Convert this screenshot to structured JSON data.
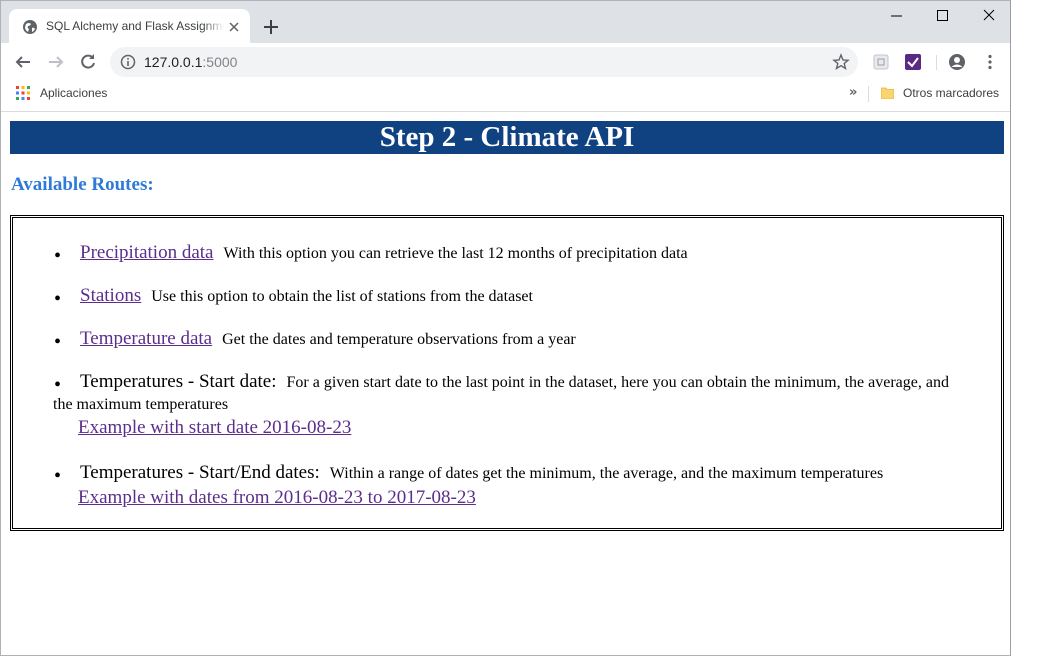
{
  "browser": {
    "tab_title": "SQL Alchemy and Flask Assignment",
    "url_host": "127.0.0.1",
    "url_port": ":5000",
    "bookmarks": {
      "apps_label": "Aplicaciones",
      "other_label": "Otros marcadores",
      "overflow": "»"
    }
  },
  "page": {
    "title": "Step 2 - Climate API",
    "routes_heading": "Available Routes:",
    "bullet": "•",
    "routes": [
      {
        "link": "Precipitation data",
        "desc": "With this option you can retrieve the last 12 months of precipitation data"
      },
      {
        "link": "Stations",
        "desc": "Use this option to obtain the list of stations from the dataset"
      },
      {
        "link": "Temperature data",
        "desc": "Get the dates and temperature observations from a year"
      },
      {
        "lead": "Temperatures - Start date:",
        "desc_line1": "For a given start date to the last point in the dataset, here you can obtain the minimum, the average, and",
        "desc_line2": "the maximum temperatures",
        "example": "Example with start date 2016-08-23"
      },
      {
        "lead": "Temperatures - Start/End dates:",
        "desc": "Within a range of dates get the minimum, the average, and the maximum temperatures",
        "example": "Example with dates from 2016-08-23 to 2017-08-23"
      }
    ]
  },
  "colors": {
    "banner": "#104281",
    "heading": "#2f7ad8",
    "link": "#5c2d8c",
    "tabstrip": "#dee1e6"
  }
}
